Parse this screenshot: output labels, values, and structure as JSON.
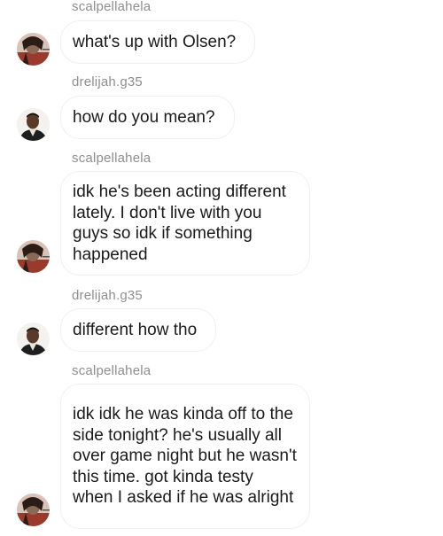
{
  "thread": {
    "messages": [
      {
        "sender": "scalpellahela",
        "text": "what's up with Olsen?",
        "avatar": "avatar-scalpellahela"
      },
      {
        "sender": "drelijah.g35",
        "text": "how do you mean?",
        "avatar": "avatar-drelijah"
      },
      {
        "sender": "scalpellahela",
        "text": "idk he's been acting different lately. I don't live with you guys so idk if something happened",
        "avatar": "avatar-scalpellahela"
      },
      {
        "sender": "drelijah.g35",
        "text": "different how tho",
        "avatar": "avatar-drelijah"
      },
      {
        "sender": "scalpellahela",
        "text": "idk idk he was kinda off to the side tonight? he's usually all over game night but he wasn't this time. got kinda testy when I asked if he was alright",
        "avatar": "avatar-scalpellahela"
      }
    ]
  }
}
